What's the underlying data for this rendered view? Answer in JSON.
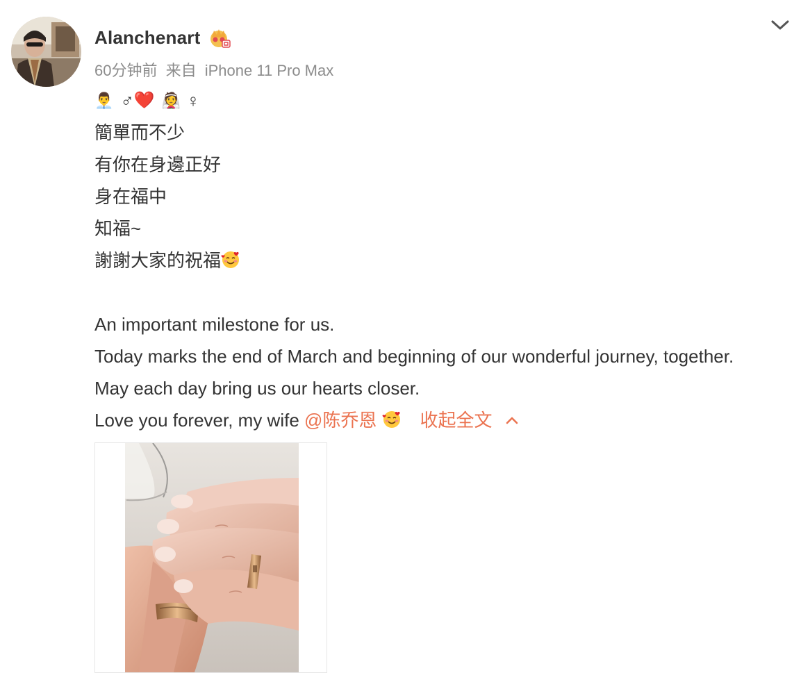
{
  "user": {
    "name": "Alanchenart",
    "avatar_icon": "avatar-photo",
    "badge_icon": "vip-crown-badge-icon"
  },
  "meta": {
    "time": "60分钟前",
    "source_prefix": "来自",
    "source": "iPhone 11 Pro Max"
  },
  "post": {
    "emoji_line": [
      "👨‍💼",
      "♂",
      "❤️",
      "👰",
      "♀"
    ],
    "lines": [
      "簡單而不少",
      "有你在身邊正好",
      "身在福中",
      "知福~",
      "謝謝大家的祝福"
    ],
    "en_lines": [
      "An important milestone for us.",
      "Today marks the end of March and beginning of our wonderful journey, together.",
      "May each day bring us our hearts closer."
    ],
    "last_line_text": "Love you forever, my wife ",
    "mention": "@陈乔恩",
    "collapse_label": "收起全文",
    "collapse_icon": "chevron-up-icon"
  },
  "colors": {
    "link": "#eb7350",
    "meta": "#8c8c8c",
    "text": "#333333"
  }
}
